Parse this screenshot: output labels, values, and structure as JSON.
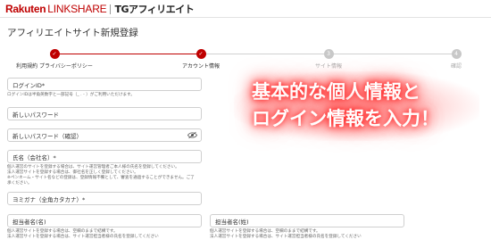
{
  "header": {
    "logo_rakuten": "Rakuten",
    "logo_linkshare": "LINKSHARE",
    "logo_tg": "TGアフィリエイト"
  },
  "page": {
    "title": "アフィリエイトサイト新規登録"
  },
  "steps": [
    {
      "label": "利用規約 プライバシーポリシー",
      "state": "done",
      "marker": "✓"
    },
    {
      "label": "アカウント情報",
      "state": "done",
      "marker": "✓"
    },
    {
      "label": "サイト情報",
      "state": "todo",
      "marker": "3"
    },
    {
      "label": "確認",
      "state": "todo",
      "marker": "4"
    }
  ],
  "form": {
    "login_id": {
      "placeholder": "ログインID*",
      "help": "ログインIDは半角英数字と一部記号（_ . - ）がご利用いただけます。"
    },
    "new_password": {
      "placeholder": "新しいパスワード"
    },
    "new_password_confirm": {
      "placeholder": "新しいパスワード（確認）",
      "icon": "eye-icon"
    },
    "full_name": {
      "placeholder": "氏名（会社名）*",
      "help": [
        "個人運営のサイトを登録する場合は、サイト運営管理者ご本人様の氏名を登録してください。",
        "法人運営サイトを登録する場合は、御社名を正しく登録してください。",
        "※ペンネーム・サイト名などの登録は、登録情報不備として、審査を通過することができません。ご了",
        "承ください。"
      ]
    },
    "name_kana": {
      "placeholder": "ヨミガナ（全角カタカナ）*"
    },
    "contact_last": {
      "placeholder": "担当者名(名)",
      "help": [
        "個人運営サイトを登録する場合は、空欄のままで結構です。",
        "法人運営サイトを登録する場合は、サイト運営担当者様の氏名を登録してください"
      ]
    },
    "contact_first": {
      "placeholder": "担当者名(姓)",
      "help": [
        "個人運営サイトを登録する場合は、空欄のままで結構です。",
        "法人運営サイトを登録する場合は、サイト運営担当者様の氏名を登録してください"
      ]
    }
  },
  "overlay": {
    "line1": "基本的な個人情報と",
    "line2": "ログイン情報を入力！"
  },
  "colors": {
    "accent": "#bf0000",
    "step_inactive": "#c8c8c8",
    "overlay_glow": "#ff3030"
  }
}
